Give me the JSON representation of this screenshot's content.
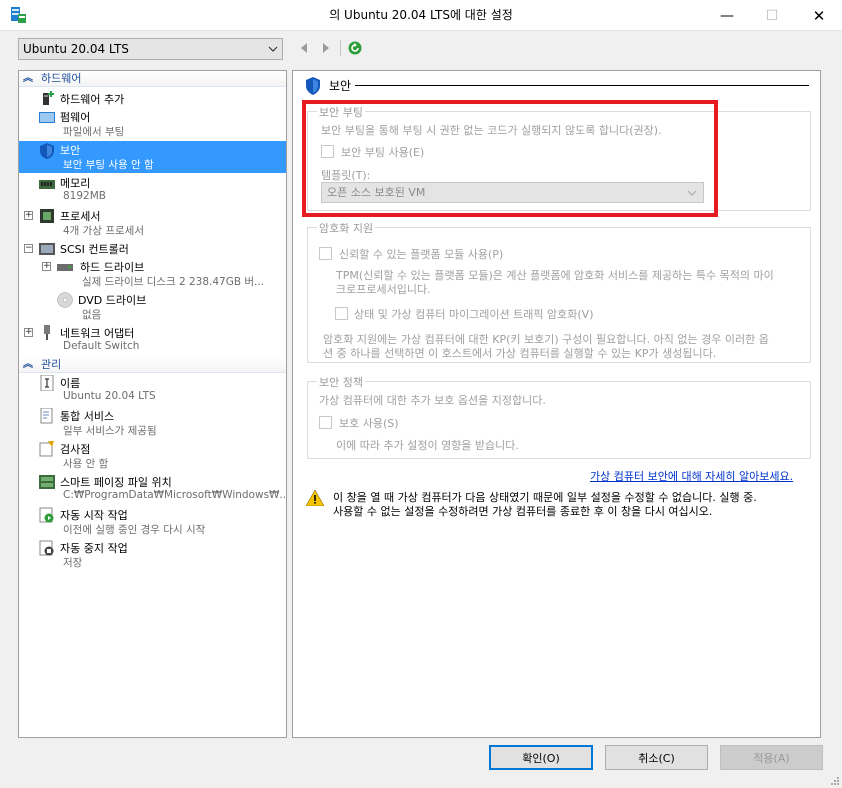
{
  "window": {
    "title": "의 Ubuntu 20.04 LTS에 대한 설정",
    "minimize_glyph": "—",
    "maximize_glyph": "☐",
    "close_glyph": "✕"
  },
  "vm_selector": {
    "value": "Ubuntu 20.04 LTS"
  },
  "tree": {
    "hardware_header": "하드웨어",
    "management_header": "관리",
    "items": [
      {
        "name": "하드웨어 추가",
        "sub": ""
      },
      {
        "name": "펌웨어",
        "sub": "파일에서 부팅"
      },
      {
        "name": "보안",
        "sub": "보안 부팅 사용 안 함"
      },
      {
        "name": "메모리",
        "sub": "8192MB"
      },
      {
        "name": "프로세서",
        "sub": "4개 가상 프로세서"
      },
      {
        "name": "SCSI 컨트롤러",
        "sub": ""
      },
      {
        "name": "하드 드라이브",
        "sub": "실제 드라이브 디스크 2 238.47GB 버..."
      },
      {
        "name": "DVD 드라이브",
        "sub": "없음"
      },
      {
        "name": "네트워크 어댑터",
        "sub": "Default Switch"
      }
    ],
    "mgmt_items": [
      {
        "name": "이름",
        "sub": "Ubuntu 20.04 LTS"
      },
      {
        "name": "통합 서비스",
        "sub": "일부 서비스가 제공됨"
      },
      {
        "name": "검사점",
        "sub": "사용 안 함"
      },
      {
        "name": "스마트 페이징 파일 위치",
        "sub": "C:₩ProgramData₩Microsoft₩Windows₩..."
      },
      {
        "name": "자동 시작 작업",
        "sub": "이전에 실행 중인 경우 다시 시작"
      },
      {
        "name": "자동 중지 작업",
        "sub": "저장"
      }
    ]
  },
  "panel": {
    "title": "보안",
    "secure_boot": {
      "group_title": "보안 부팅",
      "description": "보안 부팅을 통해 부팅 시 권한 없는 코드가 실행되지 않도록 합니다(권장).",
      "checkbox_label": "보안 부팅 사용(E)",
      "template_label": "템플릿(T):",
      "template_value": "오픈 소스 보호된 VM"
    },
    "encryption": {
      "group_title": "암호화 지원",
      "tpm_label": "신뢰할 수 있는 플랫폼 모듈 사용(P)",
      "tpm_desc_1": "TPM(신뢰할 수 있는 플랫폼 모듈)은 계산 플랫폼에 암호화 서비스를 제공하는 특수 목적의 마이",
      "tpm_desc_2": "크로프로세서입니다.",
      "migration_label": "상태 및 가상 컴퓨터 마이그레이션 트래픽 암호화(V)",
      "note_1": "암호화 지원에는 가상 컴퓨터에 대한 KP(키 보호기) 구성이 필요합니다. 아직 없는 경우 이러한 옵",
      "note_2": "션 중 하나를 선택하면 이 호스트에서 가상 컴퓨터를 실행할 수 있는 KP가 생성됩니다."
    },
    "security_policy": {
      "group_title": "보안 정책",
      "description": "가상 컴퓨터에 대한 추가 보호 옵션을 지정합니다.",
      "checkbox_label": "보호 사용(S)",
      "hint": "이에 따라 추가 설정이 영향을 받습니다."
    },
    "learn_more_link": "가상 컴퓨터 보안에 대해 자세히 알아보세요.",
    "warning_1": "이 창을 열 때 가상 컴퓨터가 다음 상태였기 때문에 일부 설정을 수정할 수 없습니다. 실행 중.",
    "warning_2": "사용할 수 없는 설정을 수정하려면 가상 컴퓨터를 종료한 후 이 창을 다시 여십시오."
  },
  "buttons": {
    "ok": "확인(O)",
    "cancel": "취소(C)",
    "apply": "적용(A)"
  },
  "colors": {
    "selection": "#3399ff",
    "highlight_box": "#e81b23",
    "link": "#0033cc",
    "section_header": "#1f4e99"
  }
}
